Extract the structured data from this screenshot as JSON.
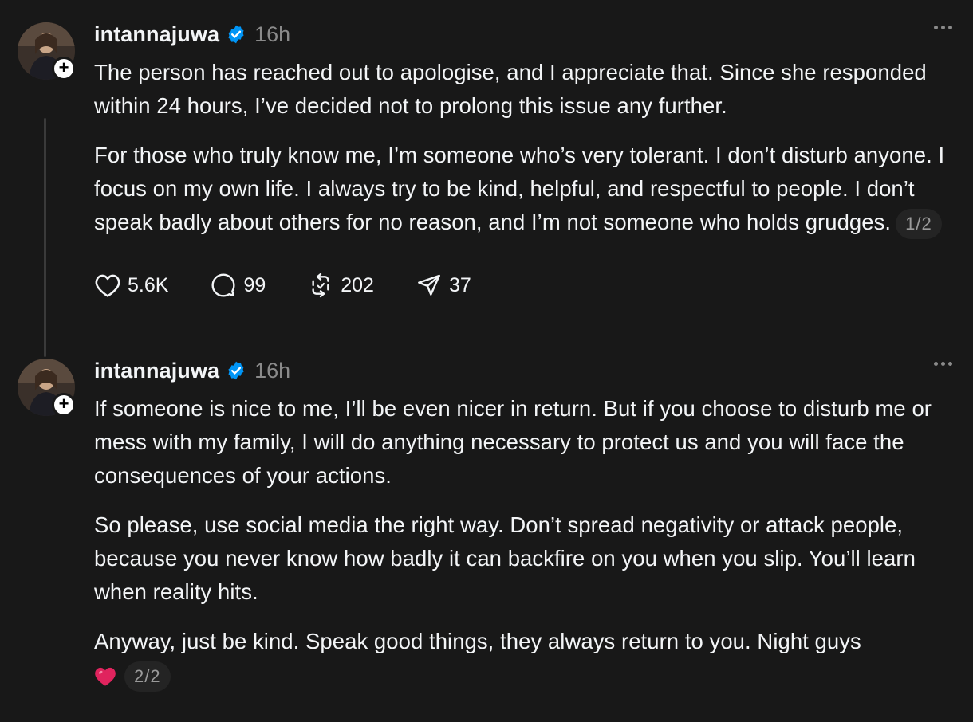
{
  "colors": {
    "background": "#181818",
    "text": "#f3f5f7",
    "muted": "#8a8a8a",
    "verified_blue": "#0095f6",
    "heart_red": "#e0245e"
  },
  "posts": [
    {
      "username": "intannajuwa",
      "time": "16h",
      "verified": true,
      "paragraphs": [
        "The person has reached out to apologise, and I appreciate that. Since she responded within 24 hours, I’ve decided not to prolong this issue any further.",
        "For those who truly know me, I’m someone who’s very tolerant. I don’t disturb anyone. I focus on my own life. I always try to be kind, helpful, and respectful to people. I don’t speak badly about others for no reason, and I’m not someone who holds grudges."
      ],
      "page_indicator": "1/2",
      "actions": {
        "likes": "5.6K",
        "replies": "99",
        "reposts": "202",
        "shares": "37"
      }
    },
    {
      "username": "intannajuwa",
      "time": "16h",
      "verified": true,
      "paragraphs": [
        "If someone is nice to me, I’ll be even nicer in return. But if you choose to disturb me or mess with my family, I will do anything necessary to protect us and you will face the consequences of your actions.",
        "So please, use social media the right way. Don’t spread negativity or attack people, because you never know how badly it can backfire on you when you slip. You’ll learn when reality hits.",
        "Anyway, just be kind. Speak good things, they always return to you. Night guys"
      ],
      "page_indicator": "2/2"
    }
  ],
  "icons": {
    "like": "heart-outline-icon",
    "reply": "speech-bubble-icon",
    "repost": "repost-arrows-icon",
    "share": "paper-plane-icon",
    "more": "ellipsis-icon",
    "verified": "verified-badge-icon",
    "follow": "plus-icon"
  }
}
